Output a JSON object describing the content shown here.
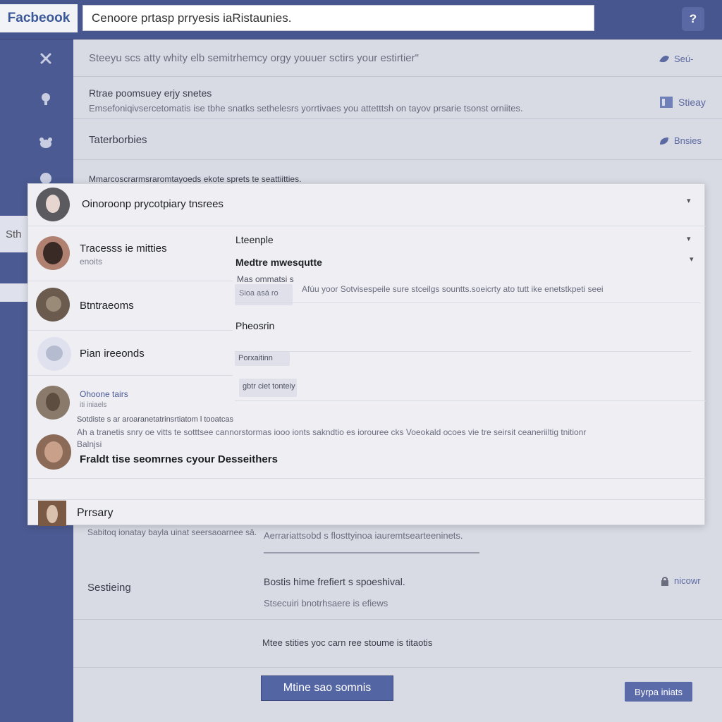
{
  "topbar": {
    "logo": "Facbeook",
    "search_value": "Cenoore prtasp prryesis iaRistaunies.",
    "help": "?"
  },
  "rail": {
    "icons": [
      "wrench-icon",
      "bulb-icon",
      "bird-icon",
      "globe-icon"
    ],
    "tab_label": "Sth"
  },
  "background": {
    "intro": "Steeyu scs atty whity elb semitrhemcy orgy youuer sctirs your estirtier\"",
    "link_top": "Seú-",
    "section1_title": "Rtrae poomsuey erjy snetes",
    "section1_desc": "Emsefoniqivsercetomatis ise tbhe snatks sethelesrs yorrtivaes you attetttsh on tayov prsarie tsonst orniites.",
    "link_settings": "Stieay",
    "section2_title": "Taterborbies",
    "link_section2": "Bnsies",
    "section3_title": "Mmarcoscrarmsraromtayoeds ekote sprets te seattiitties.",
    "lower_small": "Sabitoq ionatay bayla uinat seersaoarnee sâ.",
    "lower_right": "Aerrariattsobd s flosttyinoa iauremtsearteeninets.",
    "security_title": "Sestieing",
    "security_line1": "Bostis hime frefiert s spoeshival.",
    "security_line2": "Stsecuiri bnotrhsaere is efiews",
    "link_security": "nicowr",
    "security_line3": "Mtee stities yoc carn ree stoume is titaotis",
    "primary_button": "Mtine sao somnis",
    "secondary_button": "Byrpa iniats"
  },
  "dialog": {
    "title": "Oinoroonp prycotpiary tnsrees",
    "list": [
      {
        "label": "Tracesss ie mitties",
        "sub": "enoits"
      },
      {
        "label": "Btntraeoms",
        "sub": ""
      },
      {
        "label": "Pian ireeonds",
        "sub": ""
      },
      {
        "label": "Ohoone tairs",
        "sub": "iti iniaels"
      }
    ],
    "note_line1": "Sotdiste s ar aroaranetatrinsrtiatom l tooatcas",
    "note_line2": "Ah a tranetis snry oe vitts te sotttsee cannorstormas iooo ionts sakndtio es iorouree cks Voeokald ocoes vie tre seirsit ceaneriiltig tnitionr",
    "note_line3": "Balnjsi",
    "item5_label": "Fraldt tise seomrnes cyour Desseithers",
    "item6_label": "Prrsary",
    "panel": {
      "section_a": "Lteenple",
      "section_b": "Medtre mwesqutte",
      "field1_label": "Mas ommatsi s",
      "field1_value": "Sioa asá ro",
      "field1_desc": "Afúu yoor Sotvisespeile sure stceilgs sountts.soeicrty ato tutt ike enetstkpeti seei",
      "section_c": "Pheosrin",
      "field2_value": "Porxaitinn",
      "field3_value": "gbtr ciet tonteiy"
    }
  },
  "colors": {
    "brand": "#3b5998",
    "topbar": "#48568f",
    "rail": "#4b5a92",
    "button": "#5465a3"
  }
}
